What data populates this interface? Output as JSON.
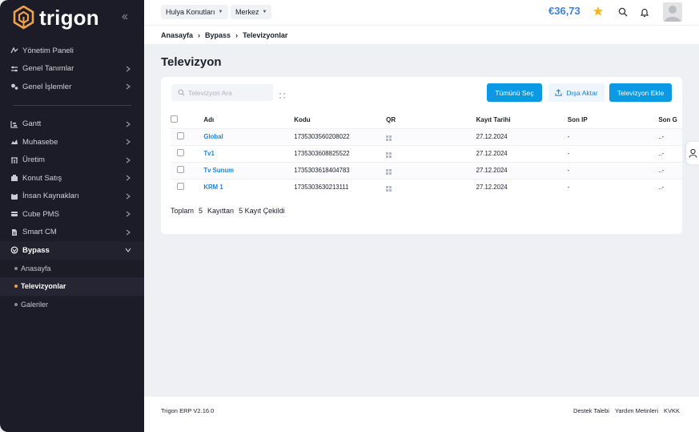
{
  "brand": {
    "name": "trigon"
  },
  "sidebar": {
    "items": [
      {
        "label": "Yönetim Paneli",
        "icon": "chart-line-icon",
        "chevron": false
      },
      {
        "label": "Genel Tanımlar",
        "icon": "sliders-icon",
        "chevron": true
      },
      {
        "label": "Genel İşlemler",
        "icon": "gears-icon",
        "chevron": true
      }
    ],
    "items2": [
      {
        "label": "Gantt",
        "icon": "gantt-chart-icon"
      },
      {
        "label": "Muhasebe",
        "icon": "ledger-icon"
      },
      {
        "label": "Üretim",
        "icon": "production-icon"
      },
      {
        "label": "Konut Satış",
        "icon": "building-icon"
      },
      {
        "label": "İnsan Kaynakları",
        "icon": "people-icon"
      },
      {
        "label": "Cube PMS",
        "icon": "card-icon"
      },
      {
        "label": "Smart CM",
        "icon": "document-icon"
      }
    ],
    "open_group": {
      "label": "Bypass",
      "icon": "bypass-icon"
    },
    "sub_items": [
      {
        "label": "Anasayfa",
        "active": false
      },
      {
        "label": "Televizyonlar",
        "active": true
      },
      {
        "label": "Galeriler",
        "active": false
      }
    ]
  },
  "topbar": {
    "property_select": "Hulya Konutları",
    "location_select": "Merkez",
    "balance": "€36,73"
  },
  "breadcrumb": [
    "Anasayfa",
    "Bypass",
    "Televizyonlar"
  ],
  "page": {
    "title": "Televizyon"
  },
  "toolbar": {
    "search_placeholder": "Televizyon Ara",
    "select_all": "Tümünü Seç",
    "export": "Dışa Aktar",
    "add": "Televizyon Ekle"
  },
  "table": {
    "headers": [
      "Adı",
      "Kodu",
      "QR",
      "Kayıt Tarihi",
      "Son IP",
      "Son G"
    ],
    "rows": [
      {
        "name": "Global",
        "code": "1735303560208022",
        "date": "27.12.2024",
        "ip": "-",
        "last": "..-"
      },
      {
        "name": "Tv1",
        "code": "1735303608825522",
        "date": "27.12.2024",
        "ip": "-",
        "last": "..-"
      },
      {
        "name": "Tv Sunum",
        "code": "1735303618404783",
        "date": "27.12.2024",
        "ip": "-",
        "last": "..-"
      },
      {
        "name": "KRM 1",
        "code": "1735303630213111",
        "date": "27.12.2024",
        "ip": "-",
        "last": "..-"
      }
    ]
  },
  "summary": {
    "prefix": "Toplam",
    "total": "5",
    "middle": "Kayıttan",
    "shown": "5 Kayıt Çekildi"
  },
  "footer": {
    "version": "Trigon ERP V2.16.0",
    "links": [
      "Destek Talebi",
      "Yardım Metinleri",
      "KVKK"
    ]
  },
  "colors": {
    "accent": "#0b99e6",
    "sidebar": "#1c1c29",
    "active_dot": "#f0a24b",
    "balance": "#3f7fe0"
  }
}
